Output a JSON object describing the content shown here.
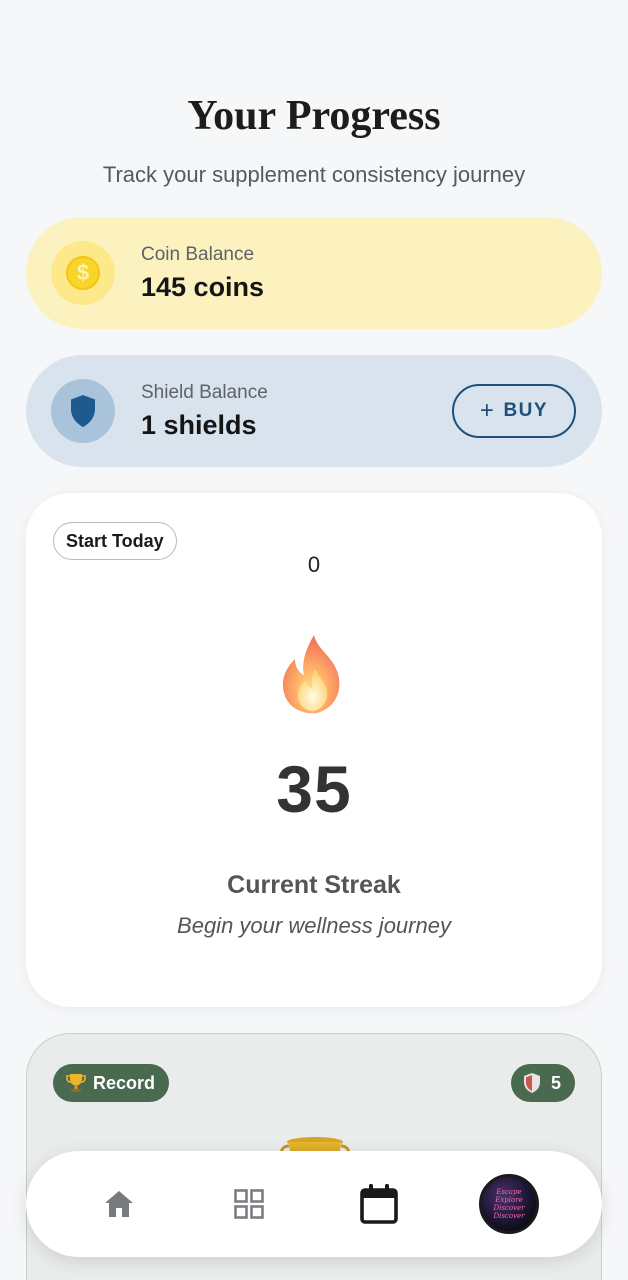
{
  "header": {
    "title": "Your Progress",
    "subtitle": "Track your supplement consistency journey"
  },
  "coin_balance": {
    "label": "Coin Balance",
    "value": "145 coins",
    "icon": "dollar-coin-icon",
    "symbol": "$"
  },
  "shield_balance": {
    "label": "Shield Balance",
    "value": "1 shields",
    "icon": "shield-icon",
    "buy_label": "BUY",
    "buy_prefix": "+"
  },
  "streak": {
    "badge": "Start Today",
    "counter": "0",
    "icon": "fire-icon",
    "value": "35",
    "label": "Current Streak",
    "message": "Begin your wellness journey"
  },
  "record": {
    "badge": "Record",
    "badge_icon": "trophy-icon",
    "shield_count": "5",
    "shield_count_icon": "shield-icon"
  },
  "bottom_nav": {
    "items": [
      {
        "name": "home",
        "icon": "home-icon",
        "active": false
      },
      {
        "name": "grid",
        "icon": "grid-icon",
        "active": false
      },
      {
        "name": "calendar",
        "icon": "calendar-icon",
        "active": true
      },
      {
        "name": "profile",
        "icon": "avatar"
      }
    ],
    "avatar_text": "Escape Explore Discover Discover"
  },
  "colors": {
    "background": "#f6f7f9",
    "coin_card": "#fbf2bf",
    "shield_card": "#d8e3ee",
    "shield_accent": "#1f4f7a",
    "record_pill": "#4a6a4f"
  }
}
